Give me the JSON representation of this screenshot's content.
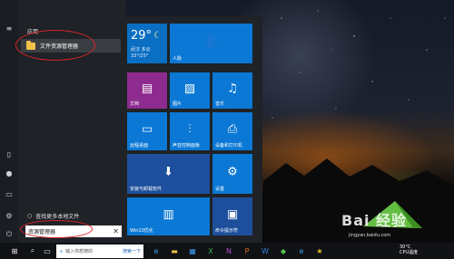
{
  "start_menu": {
    "section_label": "应用",
    "app_items": [
      {
        "label": "文件资源管理器",
        "icon": "folder-icon"
      }
    ],
    "search_hint": "查找更多本地文件",
    "search_value": "资源管理器",
    "left_rail_icons": [
      "hamburger-icon",
      "document-icon",
      "user-icon",
      "picture-icon",
      "settings-icon",
      "power-icon"
    ]
  },
  "tiles": {
    "weather": {
      "temp": "29°",
      "city_line1": "武汉 多云",
      "city_line2": "33°/25°"
    },
    "people": {
      "label": "人脉",
      "icon": "person-icon"
    },
    "documents": {
      "label": "文档",
      "icon": "bookmark-icon"
    },
    "pictures": {
      "label": "图片",
      "icon": "image-icon"
    },
    "music": {
      "label": "音乐",
      "icon": "headphones-icon"
    },
    "remote": {
      "label": "远程桌面",
      "icon": "monitor-icon"
    },
    "audio": {
      "label": "声音控制面板",
      "icon": "sliders-icon"
    },
    "printers": {
      "label": "设备和打印机",
      "icon": "printer-icon"
    },
    "install": {
      "label": "安装与卸载软件",
      "icon": "download-box-icon"
    },
    "settings": {
      "label": "设置",
      "icon": "gear-icon"
    },
    "win10": {
      "label": "Win10优化",
      "icon": "books-icon"
    },
    "cmd": {
      "label": "命令提示符",
      "icon": "terminal-icon"
    }
  },
  "taskbar": {
    "search_placeholder": "输入你想搜的",
    "search_button": "搜索一下",
    "temp": "30°C",
    "cpu": "CPU温度"
  },
  "watermark": {
    "brand": "Bai 经验",
    "url": "jingyan.baidu.com"
  },
  "colors": {
    "tile_blue": "#0a78d4",
    "tile_purple": "#8e2b8e",
    "tile_navy": "#1e4f9c",
    "annotation_red": "#d9252a"
  }
}
